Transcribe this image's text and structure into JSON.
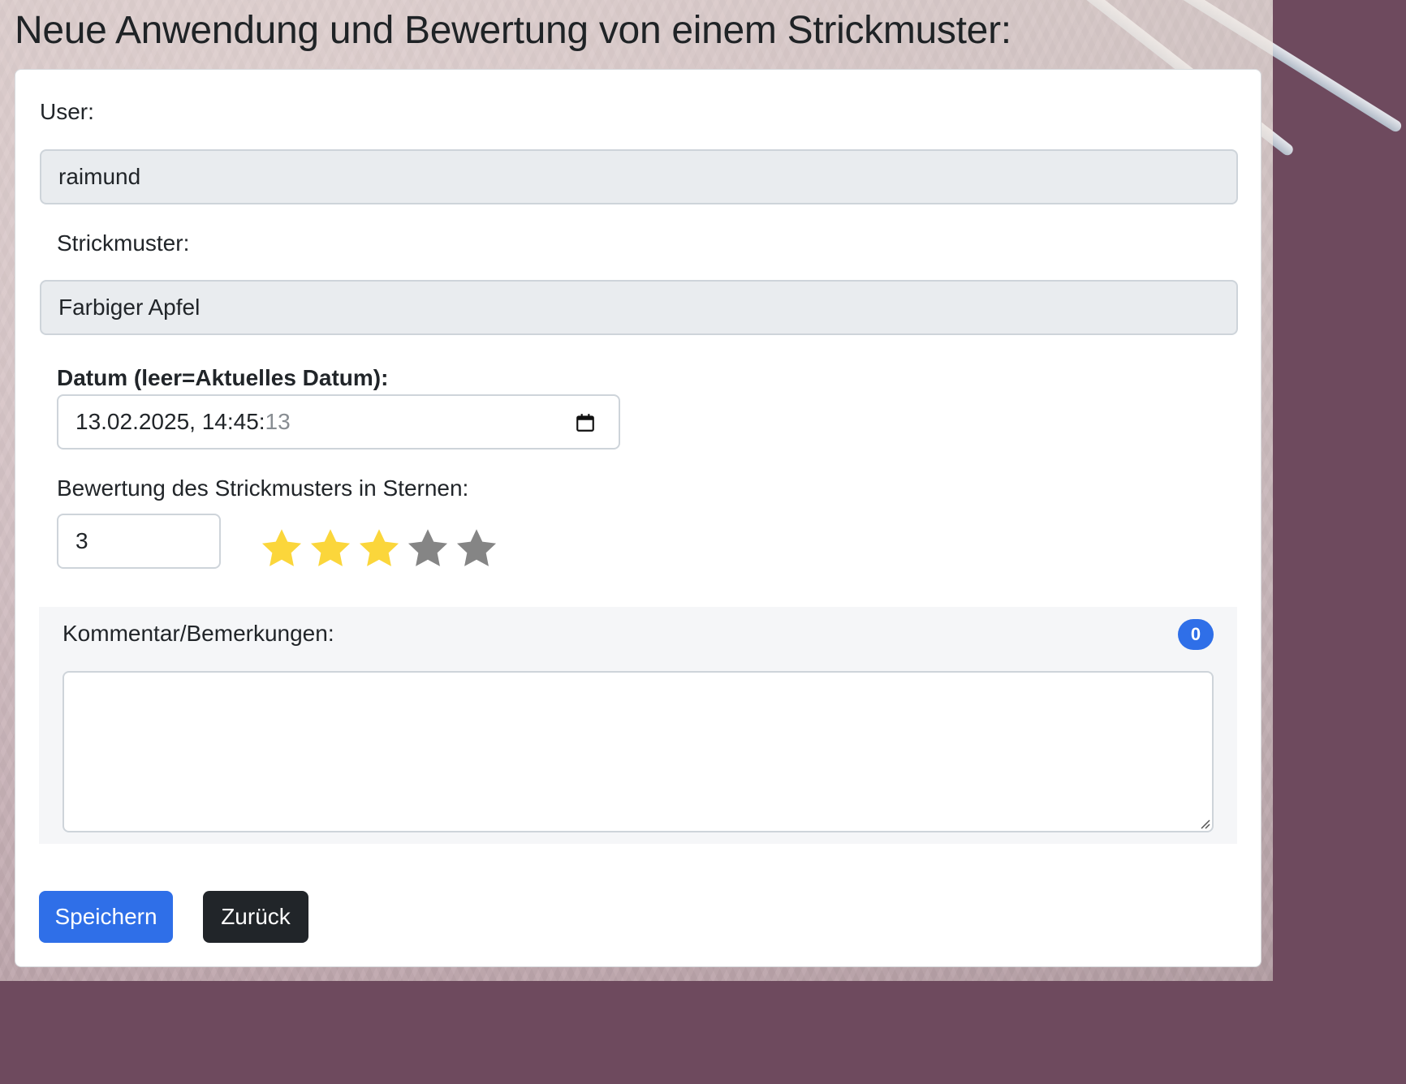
{
  "page": {
    "title": "Neue Anwendung und Bewertung von einem Strickmuster:"
  },
  "form": {
    "user_label": "User:",
    "user_value": "raimund",
    "pattern_label": "Strickmuster:",
    "pattern_value": "Farbiger Apfel",
    "date_label": "Datum (leer=Aktuelles Datum):",
    "date_value_main": "13.02.2025, 14:45:",
    "date_value_seconds": "13",
    "date_icon": "calendar-icon",
    "rating_label": "Bewertung des Strickmusters in Sternen:",
    "rating_value": "3",
    "rating_max": 5,
    "star_colors": {
      "filled": "#fbd63b",
      "empty": "#858585"
    },
    "comment_label": "Kommentar/Bemerkungen:",
    "comment_value": "",
    "comment_count": "0"
  },
  "buttons": {
    "save_label": "Speichern",
    "back_label": "Zurück"
  },
  "colors": {
    "primary": "#2f6fe8",
    "dark": "#212529",
    "readonly_bg": "#e9ecef"
  }
}
